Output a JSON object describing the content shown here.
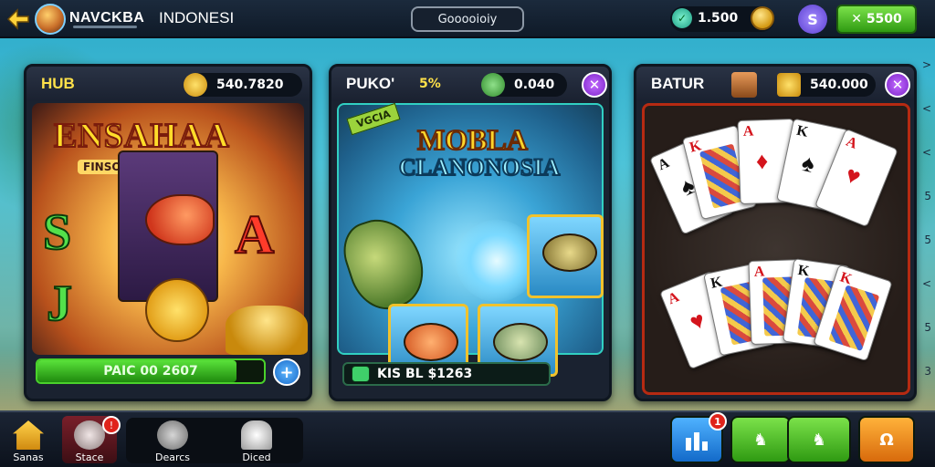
{
  "topbar": {
    "brand": "NAVCKBA",
    "region": "INDONESI",
    "search_label": "Gooooioiy",
    "gem_count": "1.500",
    "cash_label": "5500",
    "wallet_icon": "S"
  },
  "panels": {
    "slots": {
      "title": "HUB",
      "stat": "540.7820",
      "game_name": "ENSAHAA",
      "game_sub": "FINSOICA PABIDIS",
      "bar_text": "PAIC 00 2607",
      "bar_fill_percent": 88
    },
    "fishing": {
      "title": "PUKO'",
      "percent": "5%",
      "stat": "0.040",
      "tag": "VGCIA",
      "game_title_1": "MOBLA",
      "game_title_2": "CLANONOSIA",
      "bar_text": "KIS BL $1263"
    },
    "cards": {
      "title": "BATUR",
      "stat": "540.000"
    }
  },
  "bottombar": {
    "home_label": "Sanas",
    "store_label": "Stace",
    "bonus_label": "Dearcs",
    "chat_label": "Diced"
  },
  "icons": {
    "back": "arrow-left-icon",
    "close": "close-icon",
    "plus": "plus-icon",
    "home": "home-icon",
    "leader": "leaderboard-icon"
  },
  "colors": {
    "accent_green": "#4ad12b",
    "accent_purple": "#7a23c8",
    "card_border_red": "#b52a12"
  }
}
